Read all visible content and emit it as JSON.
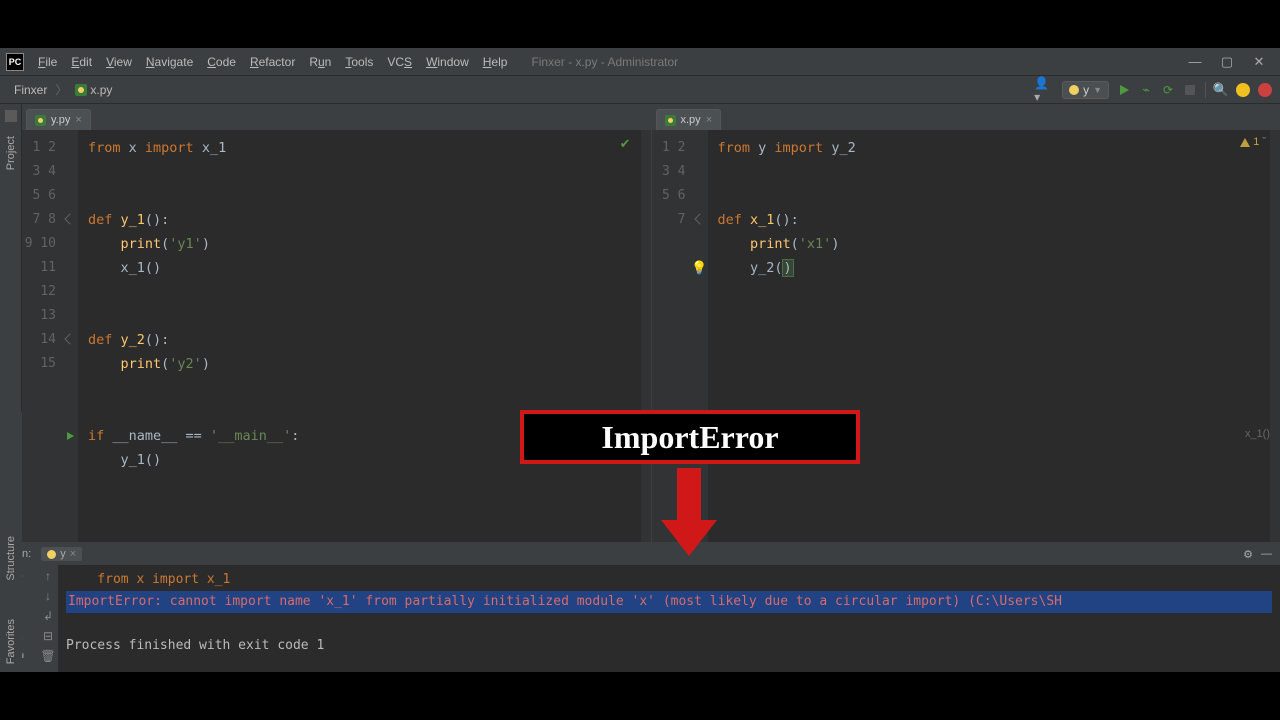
{
  "window": {
    "product_badge": "PC",
    "title": "Finxer - x.py - Administrator",
    "menus": [
      "File",
      "Edit",
      "View",
      "Navigate",
      "Code",
      "Refactor",
      "Run",
      "Tools",
      "VCS",
      "Window",
      "Help"
    ]
  },
  "breadcrumb": {
    "project": "Finxer",
    "file": "x.py"
  },
  "run_config": {
    "name": "y"
  },
  "tabs": {
    "left": "y.py",
    "right": "x.py"
  },
  "editor_left": {
    "lines": [
      "1",
      "2",
      "3",
      "4",
      "5",
      "6",
      "7",
      "8",
      "9",
      "10",
      "11",
      "12",
      "13",
      "14",
      "15"
    ],
    "code": {
      "l1": {
        "kw1": "from",
        "m": " x ",
        "kw2": "import",
        "s": " x_1"
      },
      "l4": {
        "kw": "def",
        "name": " y_1",
        "rest": "():"
      },
      "l5": {
        "fn": "print",
        "arg": "'y1'"
      },
      "l6": "x_1()",
      "l9": {
        "kw": "def",
        "name": " y_2",
        "rest": "():"
      },
      "l10": {
        "fn": "print",
        "arg": "'y2'"
      },
      "l13": {
        "kw": "if",
        "var": " __name__ ",
        "eq": "== ",
        "str": "'__main__'",
        "col": ":"
      },
      "l14": "y_1()"
    }
  },
  "editor_right": {
    "lines": [
      "1",
      "2",
      "3",
      "4",
      "5",
      "6",
      "7"
    ],
    "warn_text": "1",
    "code": {
      "l1": {
        "kw1": "from",
        "m": " y ",
        "kw2": "import",
        "s": " y_2"
      },
      "l4": {
        "kw": "def",
        "name": " x_1",
        "rest": "():"
      },
      "l5": {
        "fn": "print",
        "arg": "'x1'"
      },
      "l6_pre": "y_2(",
      "l6_post": ")"
    },
    "status": "x_1()"
  },
  "run_panel": {
    "label": "Run:",
    "tab": "y",
    "lines": {
      "trace": "    from x import x_1",
      "error": "ImportError: cannot import name 'x_1' from partially initialized module 'x' (most likely due to a circular import) (C:\\Users\\SH",
      "blank": "",
      "exit": "Process finished with exit code 1"
    }
  },
  "sidebar": {
    "top": "Project",
    "bottom1": "Structure",
    "bottom2": "Favorites"
  },
  "overlay": {
    "label": "ImportError"
  }
}
